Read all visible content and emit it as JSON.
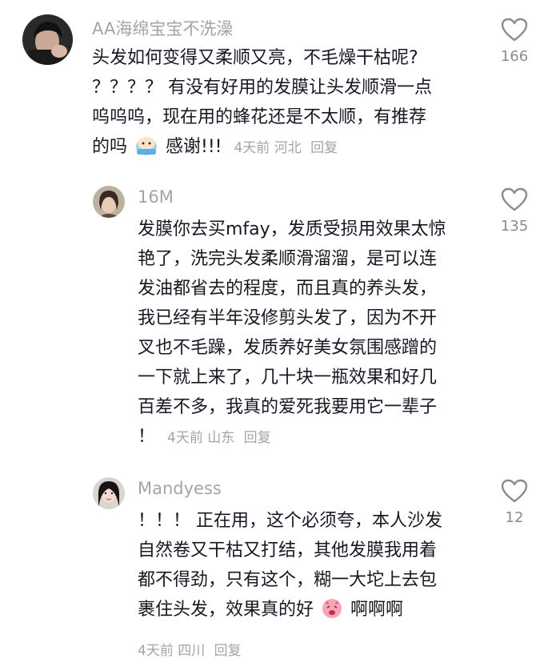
{
  "comments": [
    {
      "username": "AA海绵宝宝不洗澡",
      "lines": [
        "头发如何变得又柔顺又亮，不毛燥干枯呢?",
        "？？？？ 有没有好用的发膜让头发顺滑一点",
        "呜呜呜，现在用的蜂花还是不太顺，有推荐",
        "的吗"
      ],
      "after_emoji": "感谢!!!",
      "emoji_icon": "shy-face-emoji-icon",
      "time": "4天前",
      "location": "河北",
      "reply": "回复",
      "likes": "166"
    },
    {
      "username": "16M",
      "lines": [
        "发膜你去买mfay，发质受损用效果太惊",
        "艳了，洗完头发柔顺滑溜溜，是可以连",
        "发油都省去的程度，而且真的养头发，",
        "我已经有半年没修剪头发了，因为不开",
        "叉也不毛躁，发质养好美女氛围感蹭的",
        "一下就上来了，几十块一瓶效果和好几",
        "百差不多，我真的爱死我要用它一辈子",
        "！"
      ],
      "time": "4天前",
      "location": "山东",
      "reply": "回复",
      "likes": "135"
    },
    {
      "username": "Mandyess",
      "lines": [
        "！！！ 正在用，这个必须夸，本人沙发",
        "自然卷又干枯又打结，其他发膜我用着",
        "都不得劲，只有这个，糊一大坨上去包",
        "裹住头发，效果真的好"
      ],
      "after_emoji": "啊啊啊",
      "emoji_icon": "excited-face-emoji-icon",
      "time": "4天前",
      "location": "四川",
      "reply": "回复",
      "likes": "12"
    }
  ]
}
